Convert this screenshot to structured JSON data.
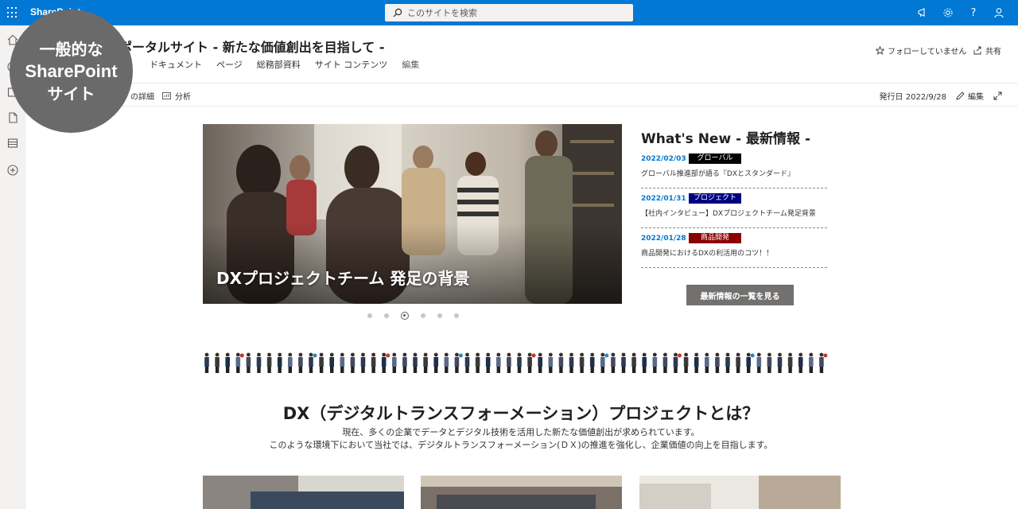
{
  "suite": {
    "brand": "SharePoint",
    "search_placeholder": "このサイトを検索"
  },
  "site": {
    "title": "ポータルサイト - 新たな価値創出を目指して -",
    "nav": [
      "ドキュメント",
      "ページ",
      "総務部資料",
      "サイト コンテンツ",
      "編集"
    ],
    "follow_label": "フォローしていません",
    "share_label": "共有"
  },
  "command_bar": {
    "details_label": "の詳細",
    "analytics_label": "分析",
    "published_label": "発行日 2022/9/28",
    "edit_label": "編集"
  },
  "hero": {
    "caption": "DXプロジェクトチーム 発足の背景",
    "dots_total": 6,
    "dots_active": 3
  },
  "news": {
    "title": "What's New - 最新情報 -",
    "items": [
      {
        "date": "2022/02/03",
        "tag": "グローバル",
        "tag_color": "#000000",
        "text": "グローバル推進部が語る『DXとスタンダード』"
      },
      {
        "date": "2022/01/31",
        "tag": "プロジェクト",
        "tag_color": "#000080",
        "text": "【社内インタビュー】DXプロジェクトチーム発足背景"
      },
      {
        "date": "2022/01/28",
        "tag": "商品開発",
        "tag_color": "#8b0000",
        "text": "商品開発におけるDXの利活用のコツ！！"
      }
    ],
    "more_label": "最新情報の一覧を見る"
  },
  "dx": {
    "title": "DX（デジタルトランスフォーメーション）プロジェクトとは？",
    "line1": "現在、多くの企業でデータとデジタル技術を活用した新たな価値創出が求められています。",
    "line2": "このような環境下において当社では、デジタルトランスフォーメーション(ＤＸ)の推進を強化し、企業価値の向上を目指します。"
  },
  "badge": {
    "line1": "一般的な",
    "line2": "SharePoint",
    "line3": "サイト"
  },
  "colors": {
    "suite_blue": "#0078d4",
    "badge_gray": "#6b6a6a"
  }
}
